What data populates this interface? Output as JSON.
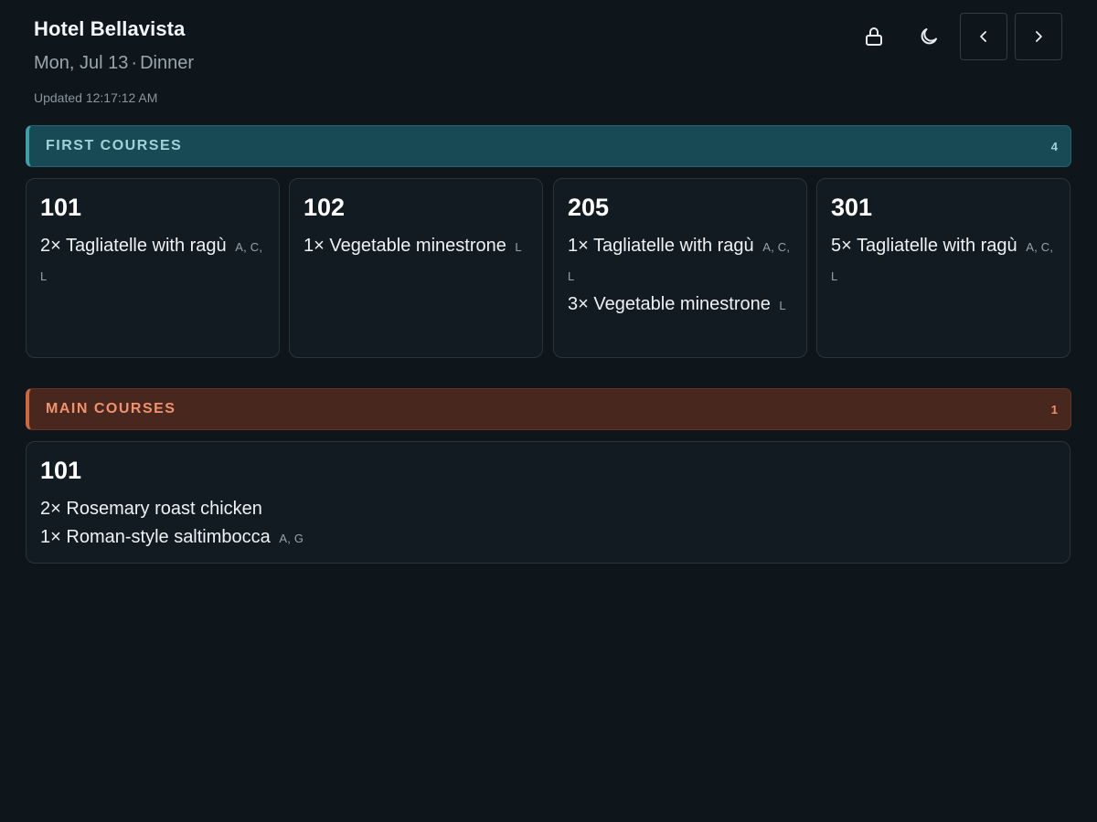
{
  "header": {
    "hotel": "Hotel Bellavista",
    "date": "Mon, Jul 13",
    "separator": "·",
    "service": "Dinner",
    "updated": "Updated 12:17:12 AM"
  },
  "toolbar": {
    "lock_icon": "lock-icon",
    "theme_icon": "moon-icon",
    "prev_icon": "chevron-left-icon",
    "next_icon": "chevron-right-icon"
  },
  "sections": {
    "first": {
      "title": "FIRST COURSES",
      "count": "4",
      "accent": "#3f9ea8",
      "cards": [
        {
          "room": "101",
          "items": [
            {
              "qty": "2×",
              "name": "Tagliatelle with ragù",
              "allergens": "A, C, L"
            }
          ]
        },
        {
          "room": "102",
          "items": [
            {
              "qty": "1×",
              "name": "Vegetable minestrone",
              "allergens": "L"
            }
          ]
        },
        {
          "room": "205",
          "items": [
            {
              "qty": "1×",
              "name": "Tagliatelle with ragù",
              "allergens": "A, C, L"
            },
            {
              "qty": "3×",
              "name": "Vegetable minestrone",
              "allergens": "L"
            }
          ]
        },
        {
          "room": "301",
          "items": [
            {
              "qty": "5×",
              "name": "Tagliatelle with ragù",
              "allergens": "A, C, L"
            }
          ]
        }
      ]
    },
    "main": {
      "title": "MAIN COURSES",
      "count": "1",
      "accent": "#d0653f",
      "cards": [
        {
          "room": "101",
          "items": [
            {
              "qty": "2×",
              "name": "Rosemary roast chicken",
              "allergens": ""
            },
            {
              "qty": "1×",
              "name": "Roman-style saltimbocca",
              "allergens": "A, G"
            }
          ]
        }
      ]
    }
  }
}
